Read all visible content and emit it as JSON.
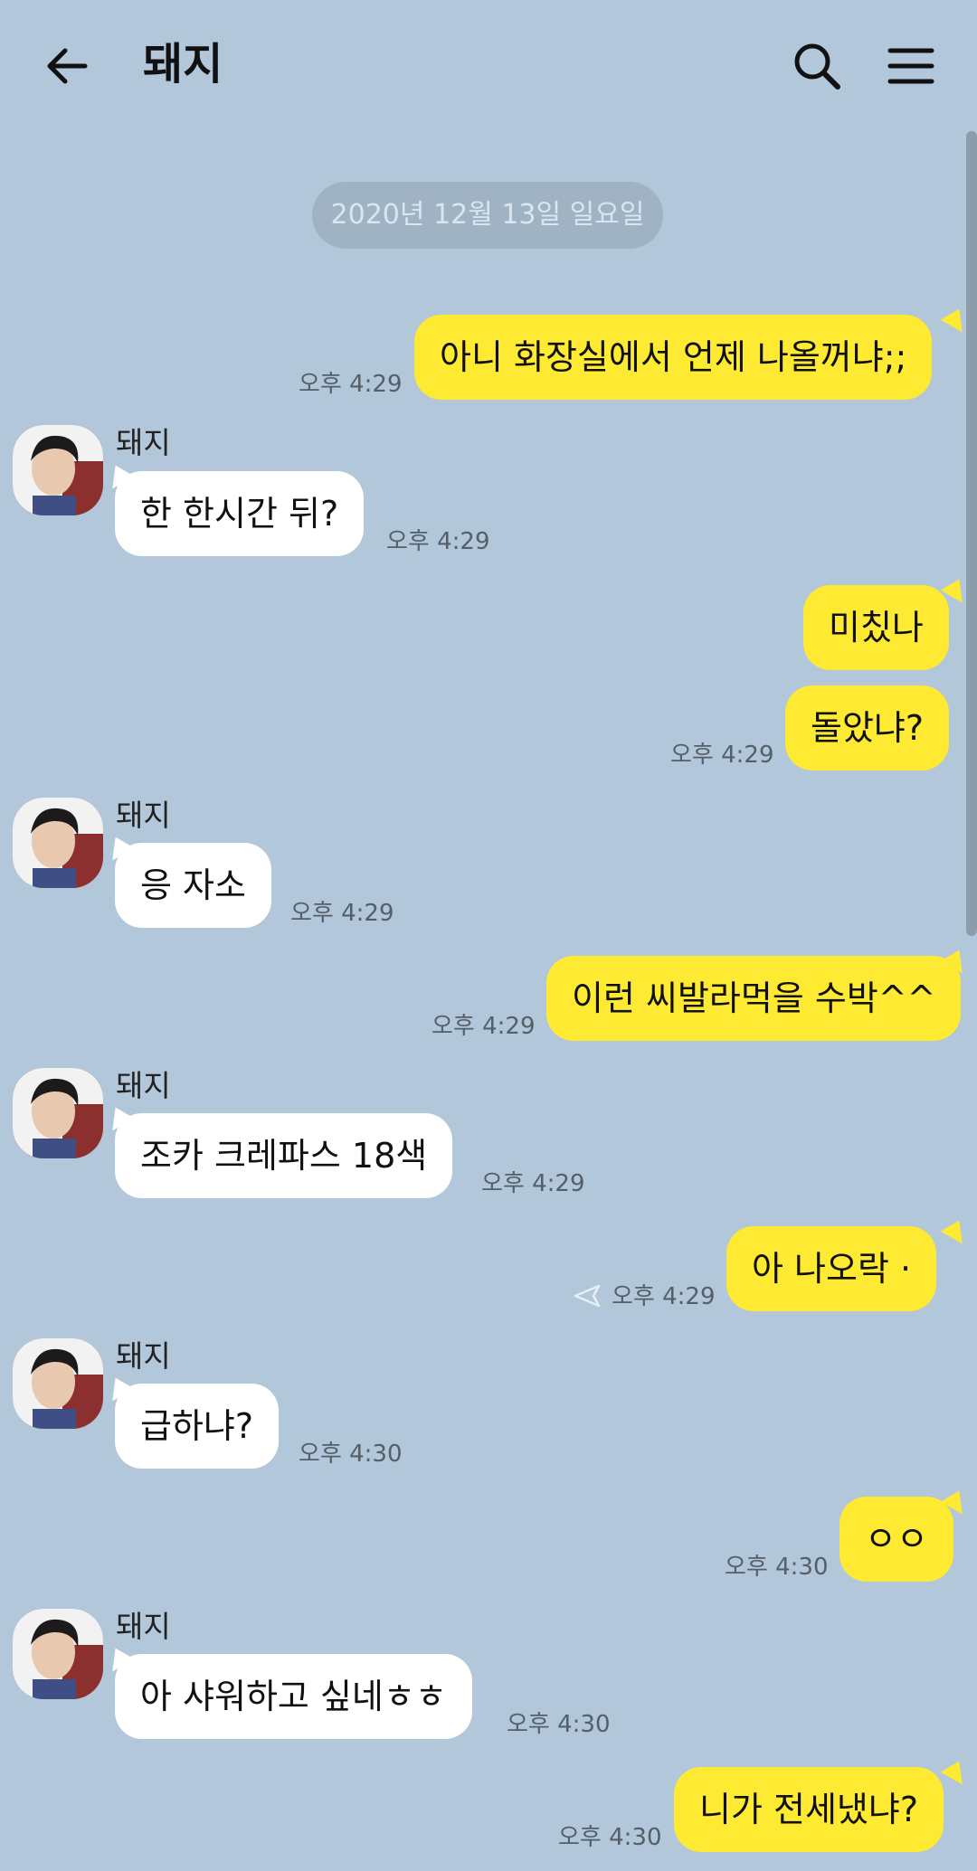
{
  "header": {
    "title": "돼지"
  },
  "date_divider": "2020년 12월 13일 일요일",
  "messages": [
    {
      "from": "me",
      "text": "아니 화장실에서 언제 나올꺼냐;;",
      "time": "오후 4:29"
    },
    {
      "from": "other",
      "sender": "돼지",
      "text": "한 한시간 뒤?",
      "time": "오후 4:29"
    },
    {
      "from": "me",
      "text": "미칬나",
      "time": ""
    },
    {
      "from": "me",
      "text": "돌았냐?",
      "time": "오후 4:29"
    },
    {
      "from": "other",
      "sender": "돼지",
      "text": "응 자소",
      "time": "오후 4:29"
    },
    {
      "from": "me",
      "text": "이런 씨발라먹을 수박^^",
      "time": "오후 4:29"
    },
    {
      "from": "other",
      "sender": "돼지",
      "text": "조카 크레파스 18색",
      "time": "오후 4:29"
    },
    {
      "from": "me",
      "text": "아 나오락 ·",
      "time": "오후 4:29"
    },
    {
      "from": "other",
      "sender": "돼지",
      "text": "급하냐?",
      "time": "오후 4:30"
    },
    {
      "from": "me",
      "text": "ㅇㅇ",
      "time": "오후 4:30"
    },
    {
      "from": "other",
      "sender": "돼지",
      "text": "아 샤워하고 싶네ㅎㅎ",
      "time": "오후 4:30"
    },
    {
      "from": "me",
      "text": "니가 전세냈냐?",
      "time": "오후 4:30"
    }
  ],
  "icons": {
    "back": "arrow-left-icon",
    "search": "search-icon",
    "menu": "hamburger-menu-icon",
    "sent": "paper-plane-icon"
  },
  "colors": {
    "background": "#b2c7da",
    "my_bubble": "#fee933",
    "their_bubble": "#ffffff",
    "date_pill": "#9fb3c4"
  }
}
